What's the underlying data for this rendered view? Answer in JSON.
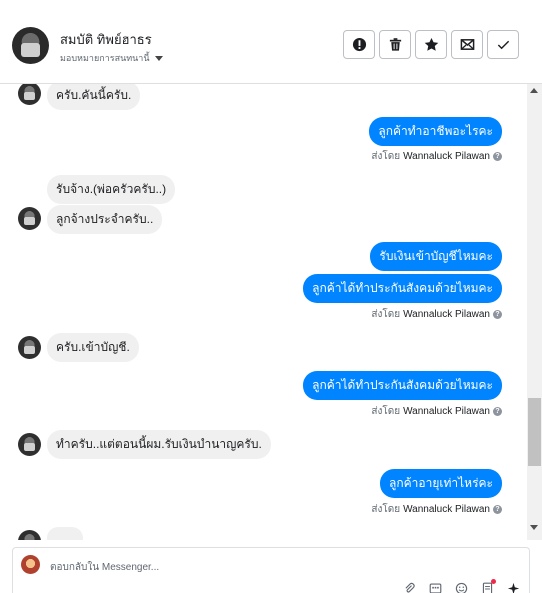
{
  "header": {
    "contact_name": "สมบัติ ทิพย์ฮาธร",
    "assign_label": "มอบหมายการสนทนานี้",
    "actions": [
      {
        "icon": "exclamation-icon"
      },
      {
        "icon": "trash-icon"
      },
      {
        "icon": "star-icon"
      },
      {
        "icon": "mark-unread-icon"
      },
      {
        "icon": "checkmark-icon"
      }
    ]
  },
  "thread": {
    "m1": "ครับ.คันนี้ครับ.",
    "m2": "ลูกค้าทำอาชีพอะไรคะ",
    "m3": "รับจ้าง.(พ่อครัวครับ..)",
    "m4": "ลูกจ้างประจำครับ..",
    "m5": "รับเงินเข้าบัญชีไหมคะ",
    "m6": "ลูกค้าได้ทำประกันสังคมด้วยไหมคะ",
    "m7": "ครับ.เข้าบัญชี.",
    "m8": "ลูกค้าได้ทำประกันสังคมด้วยไหมคะ",
    "m9": "ทำครับ..แต่ตอนนี้ผม.รับเงินบำนาญครับ.",
    "m10": "ลูกค้าอายุเท่าไหร่คะ",
    "sent_by_prefix": "ส่งโดย",
    "agent_name": "Wannaluck Pilawan"
  },
  "composer": {
    "placeholder": "ตอบกลับใน Messenger..."
  },
  "colors": {
    "outgoing_bubble": "#0084ff",
    "incoming_bubble": "#f1f0f0"
  }
}
